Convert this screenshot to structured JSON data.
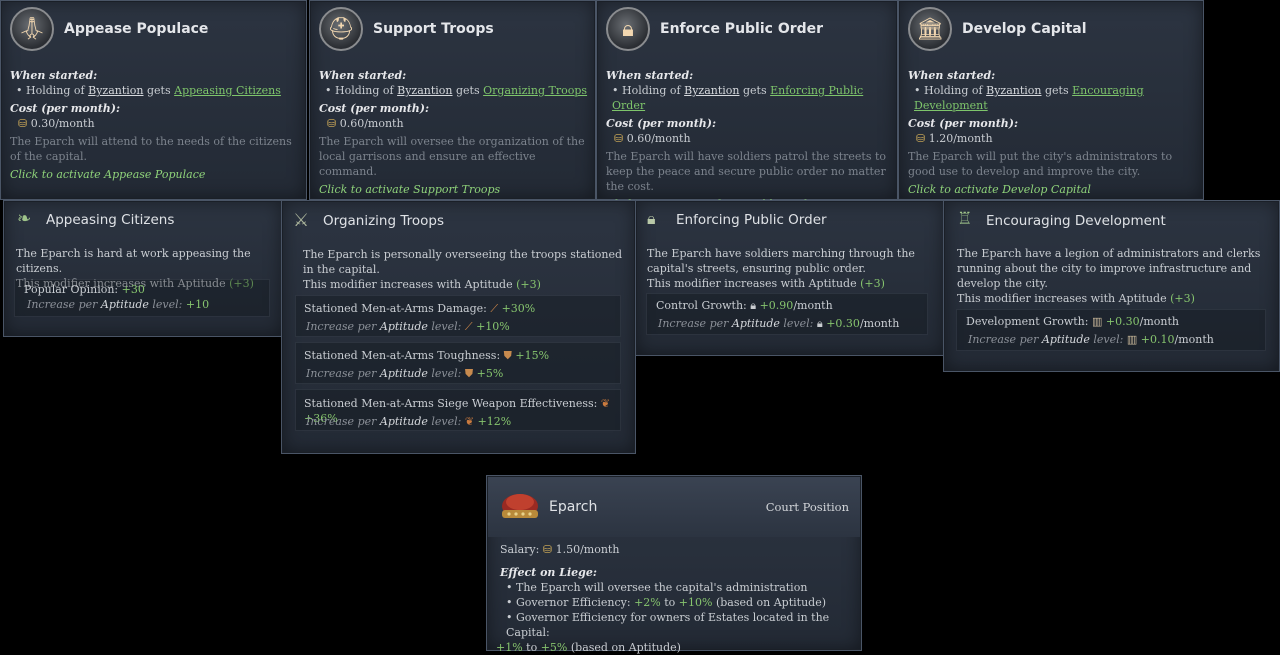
{
  "activities": [
    {
      "title": "Appease Populace",
      "icon": "praying-hands-icon",
      "when_started": "When started:",
      "holding_prefix": "• Holding of",
      "holding": "Byzantion",
      "gets": "gets",
      "modifier_link": "Appeasing Citizens",
      "cost_label": "Cost (per month):",
      "cost": "0.30/month",
      "desc": "The Eparch will attend to the needs of the citizens of the capital.",
      "cta": "Click to activate Appease Populace"
    },
    {
      "title": "Support Troops",
      "icon": "helmet-icon",
      "when_started": "When started:",
      "holding_prefix": "• Holding of",
      "holding": "Byzantion",
      "gets": "gets",
      "modifier_link": "Organizing Troops",
      "cost_label": "Cost (per month):",
      "cost": "0.60/month",
      "desc": "The Eparch will oversee the organization of the local garrisons and ensure an effective command.",
      "cta": "Click to activate Support Troops"
    },
    {
      "title": "Enforce Public Order",
      "icon": "padlock-icon",
      "when_started": "When started:",
      "holding_prefix": "• Holding of",
      "holding": "Byzantion",
      "gets": "gets",
      "modifier_link": "Enforcing Public Order",
      "cost_label": "Cost (per month):",
      "cost": "0.60/month",
      "desc": "The Eparch will have soldiers patrol the streets to keep the peace and secure public order no matter the cost.",
      "cta": "Click to activate Enforce Public Order"
    },
    {
      "title": "Develop Capital",
      "icon": "building-icon",
      "when_started": "When started:",
      "holding_prefix": "• Holding of",
      "holding": "Byzantion",
      "gets": "gets",
      "modifier_link": "Encouraging Development",
      "cost_label": "Cost (per month):",
      "cost": "1.20/month",
      "desc": "The Eparch will put the city's administrators to good use to develop and improve the city.",
      "cta": "Click to activate Develop Capital"
    }
  ],
  "modifiers": {
    "appeasing": {
      "title": "Appeasing Citizens",
      "desc": "The Eparch is hard at work appeasing the citizens.",
      "scale": "This modifier increases with Aptitude",
      "scale_val": "(+3)",
      "effects": [
        {
          "label": "Popular Opinion:",
          "value": "+30",
          "inc_label": "Increase per",
          "inc_attr": "Aptitude",
          "inc_level": "level:",
          "inc_value": "+10"
        }
      ]
    },
    "organizing": {
      "title": "Organizing Troops",
      "desc": "The Eparch is personally overseeing the troops stationed in the capital.",
      "scale": "This modifier increases with Aptitude",
      "scale_val": "(+3)",
      "effects": [
        {
          "label": "Stationed Men-at-Arms Damage:",
          "value": "+30%",
          "inc_label": "Increase per",
          "inc_attr": "Aptitude",
          "inc_level": "level:",
          "inc_value": "+10%"
        },
        {
          "label": "Stationed Men-at-Arms Toughness:",
          "value": "+15%",
          "inc_label": "Increase per",
          "inc_attr": "Aptitude",
          "inc_level": "level:",
          "inc_value": "+5%"
        },
        {
          "label": "Stationed Men-at-Arms Siege Weapon Effectiveness:",
          "value": "+36%",
          "inc_label": "Increase per",
          "inc_attr": "Aptitude",
          "inc_level": "level:",
          "inc_value": "+12%"
        }
      ]
    },
    "enforcing": {
      "title": "Enforcing Public Order",
      "desc": "The Eparch have soldiers marching through the capital's streets, ensuring public order.",
      "scale": "This modifier increases with Aptitude",
      "scale_val": "(+3)",
      "effects": [
        {
          "label": "Control Growth:",
          "value": "+0.90",
          "unit": "/month",
          "inc_label": "Increase per",
          "inc_attr": "Aptitude",
          "inc_level": "level:",
          "inc_value": "+0.30",
          "inc_unit": "/month"
        }
      ]
    },
    "encouraging": {
      "title": "Encouraging Development",
      "desc": "The Eparch have a legion of administrators and clerks running about the city to improve infrastructure and develop the city.",
      "scale": "This modifier increases with Aptitude",
      "scale_val": "(+3)",
      "effects": [
        {
          "label": "Development Growth:",
          "value": "+0.30",
          "unit": "/month",
          "inc_label": "Increase per",
          "inc_attr": "Aptitude",
          "inc_level": "level:",
          "inc_value": "+0.10",
          "inc_unit": "/month"
        }
      ]
    }
  },
  "eparch": {
    "title": "Eparch",
    "type": "Court Position",
    "salary_label": "Salary:",
    "salary": "1.50/month",
    "effect_label": "Effect on Liege:",
    "b1": "• The Eparch will oversee the capital's administration",
    "b2_prefix": "• Governor Efficiency:",
    "b2_v1": "+2%",
    "b2_to": "to",
    "b2_v2": "+10%",
    "b2_suffix": "(based on Aptitude)",
    "b3_prefix": "• Governor Efficiency for owners of Estates located in the Capital:",
    "b3_v1": "+1%",
    "b3_to": "to",
    "b3_v2": "+5%",
    "b3_suffix": "(based on Aptitude)"
  }
}
